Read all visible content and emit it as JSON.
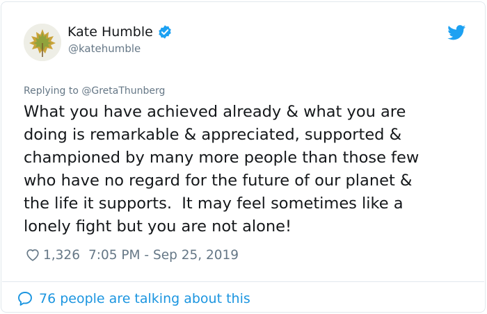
{
  "author": {
    "display_name": "Kate Humble",
    "handle": "@katehumble",
    "verified": true
  },
  "reply_context": "Replying to @GretaThunberg",
  "tweet": {
    "lines": [
      "What you have achieved already & what you are",
      "doing is remarkable & appreciated, supported &",
      "championed by many more people than those few",
      "who have no regard for the future of our planet &",
      "the life it supports.  It may feel sometimes like a",
      "lonely fight but you are not alone!"
    ]
  },
  "meta": {
    "likes": "1,326",
    "timestamp": "7:05 PM - Sep 25, 2019"
  },
  "footer": {
    "talking_label": "76 people are talking about this"
  },
  "icons": {
    "verified": "verified-badge-icon",
    "brand": "twitter-bird-icon",
    "like": "heart-icon",
    "reply": "speech-bubble-icon"
  },
  "colors": {
    "accent": "#1da1f2",
    "link": "#1b95e0",
    "secondary_text": "#657786",
    "primary_text": "#14171a"
  }
}
